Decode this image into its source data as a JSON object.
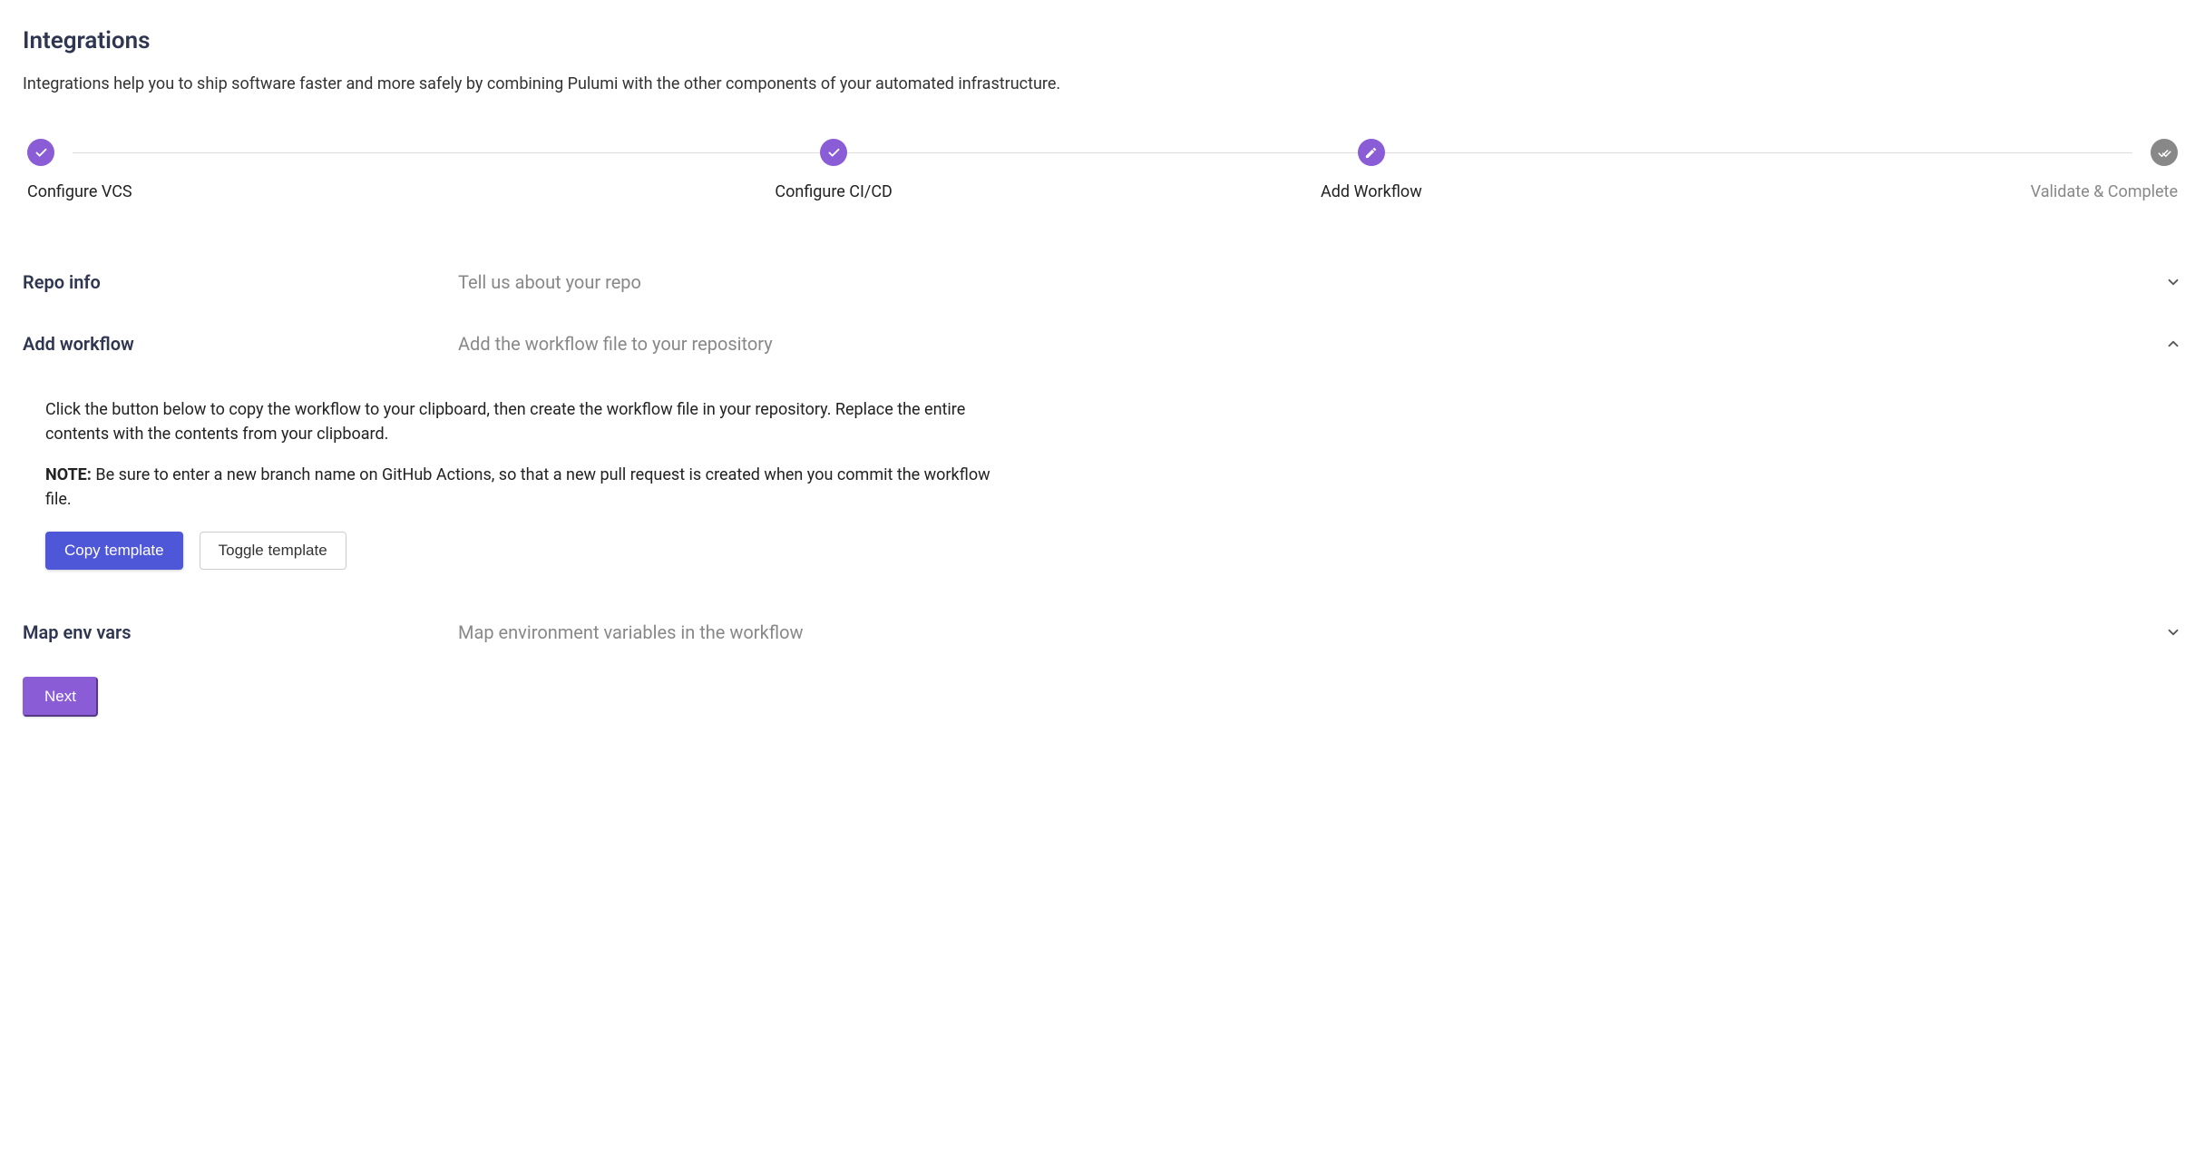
{
  "title": "Integrations",
  "description": "Integrations help you to ship software faster and more safely by combining Pulumi with the other components of your automated infrastructure.",
  "stepper": {
    "steps": [
      {
        "label": "Configure VCS",
        "state": "completed",
        "icon": "check"
      },
      {
        "label": "Configure CI/CD",
        "state": "completed",
        "icon": "check"
      },
      {
        "label": "Add Workflow",
        "state": "active",
        "icon": "pencil"
      },
      {
        "label": "Validate & Complete",
        "state": "inactive",
        "icon": "double-check"
      }
    ]
  },
  "sections": {
    "repo_info": {
      "title": "Repo info",
      "desc": "Tell us about your repo",
      "expanded": false
    },
    "add_workflow": {
      "title": "Add workflow",
      "desc": "Add the workflow file to your repository",
      "expanded": true,
      "body_p1": "Click the button below to copy the workflow to your clipboard, then create the workflow file in your repository. Replace the entire contents with the contents from your clipboard.",
      "note_label": "NOTE:",
      "note_text": " Be sure to enter a new branch name on GitHub Actions, so that a new pull request is created when you commit the workflow file.",
      "copy_btn": "Copy template",
      "toggle_btn": "Toggle template"
    },
    "map_env_vars": {
      "title": "Map env vars",
      "desc": "Map environment variables in the workflow",
      "expanded": false
    }
  },
  "next_btn": "Next"
}
